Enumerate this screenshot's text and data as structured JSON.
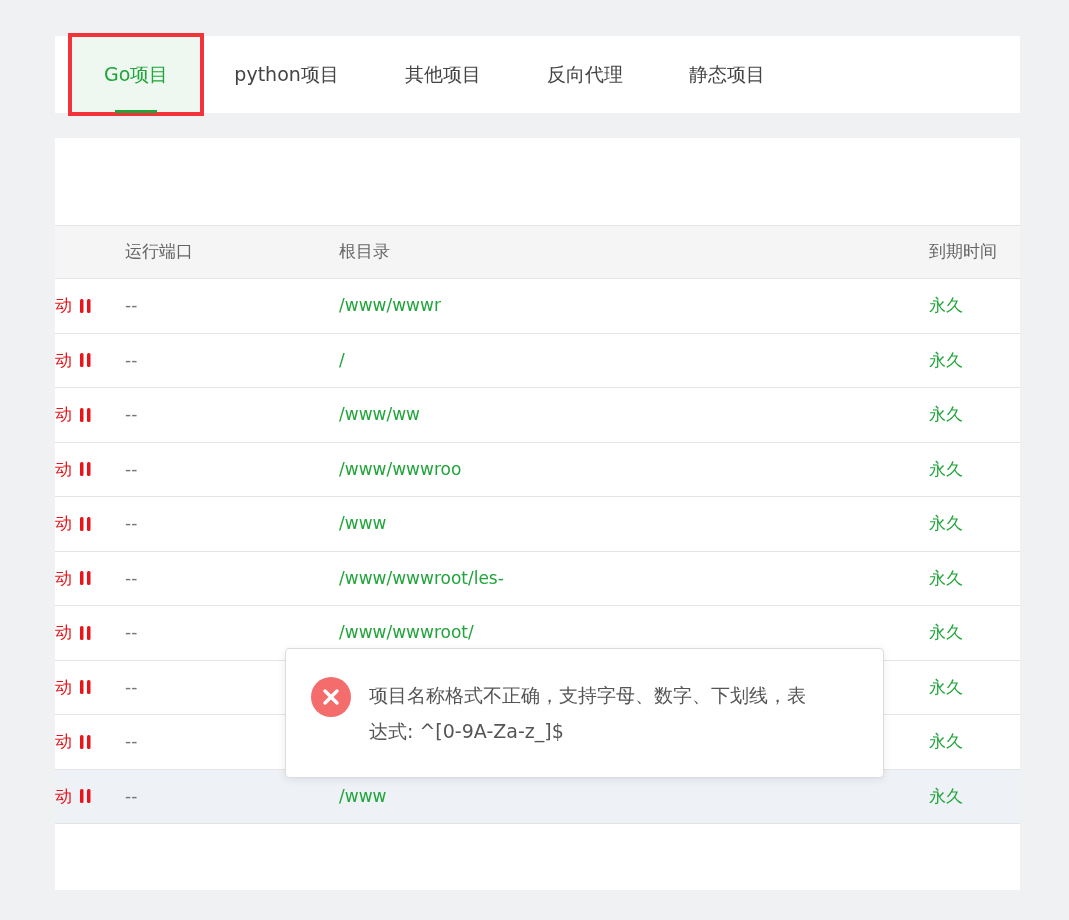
{
  "tabs": [
    {
      "label": "Go项目",
      "selected": true,
      "outlined": true
    },
    {
      "label": "python项目",
      "selected": false,
      "outlined": false
    },
    {
      "label": "其他项目",
      "selected": false,
      "outlined": false
    },
    {
      "label": "反向代理",
      "selected": false,
      "outlined": false
    },
    {
      "label": "静态项目",
      "selected": false,
      "outlined": false
    }
  ],
  "table": {
    "columns": [
      "运行端口",
      "根目录",
      "到期时间"
    ],
    "rows": [
      {
        "status": "动",
        "port": "--",
        "path": "/www/wwwr",
        "expiry": "永久",
        "highlighted": false
      },
      {
        "status": "动",
        "port": "--",
        "path": "/",
        "expiry": "永久",
        "highlighted": false
      },
      {
        "status": "动",
        "port": "--",
        "path": "/www/ww",
        "expiry": "永久",
        "highlighted": false
      },
      {
        "status": "动",
        "port": "--",
        "path": "/www/wwwroo",
        "expiry": "永久",
        "highlighted": false
      },
      {
        "status": "动",
        "port": "--",
        "path": "/www",
        "expiry": "永久",
        "highlighted": false
      },
      {
        "status": "动",
        "port": "--",
        "path": "/www/wwwroot/les-",
        "expiry": "永久",
        "highlighted": false
      },
      {
        "status": "动",
        "port": "--",
        "path": "/www/wwwroot/",
        "expiry": "永久",
        "highlighted": false
      },
      {
        "status": "动",
        "port": "--",
        "expiry": "永久",
        "highlighted": false
      },
      {
        "status": "动",
        "port": "--",
        "expiry": "永久",
        "highlighted": false
      },
      {
        "status": "动",
        "port": "--",
        "path": "/www",
        "expiry": "永久",
        "highlighted": true
      }
    ]
  },
  "toast": {
    "kind": "error",
    "message": "项目名称格式不正确，支持字母、数字、下划线，表达式: ^[0-9A-Za-z_]$"
  }
}
